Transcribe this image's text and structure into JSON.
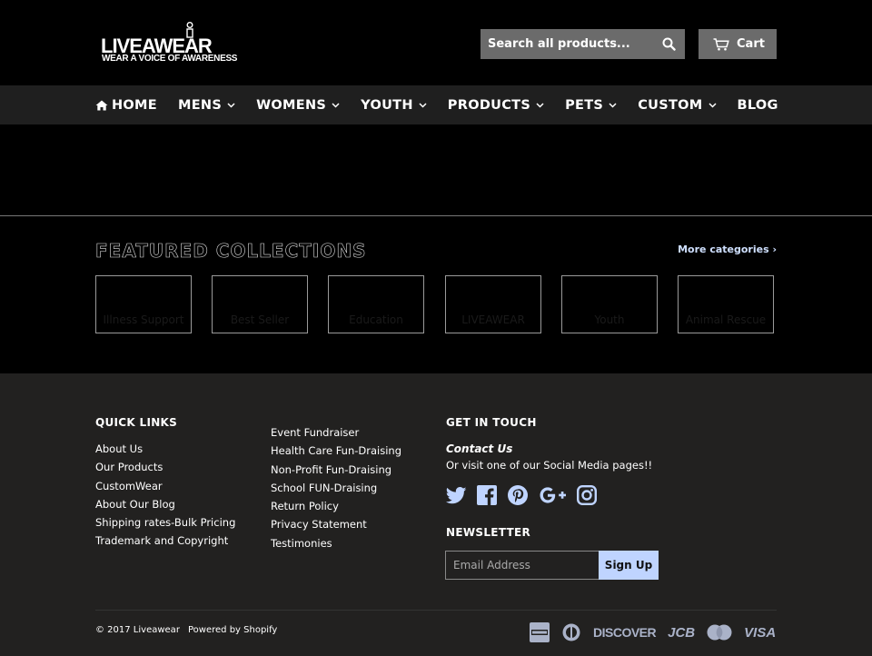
{
  "header": {
    "logo_text": "LIVEAWEAR",
    "logo_tagline": "WEAR A VOICE OF AWARENESS",
    "search_placeholder": "Search all products...",
    "cart_label": "Cart"
  },
  "nav": {
    "items": [
      {
        "label": "HOME",
        "icon": "home-icon",
        "dropdown": false
      },
      {
        "label": "MENS",
        "dropdown": true
      },
      {
        "label": "WOMENS",
        "dropdown": true
      },
      {
        "label": "YOUTH",
        "dropdown": true
      },
      {
        "label": "PRODUCTS",
        "dropdown": true
      },
      {
        "label": "PETS",
        "dropdown": true
      },
      {
        "label": "CUSTOM",
        "dropdown": true
      },
      {
        "label": "BLOG",
        "dropdown": false
      }
    ]
  },
  "featured": {
    "title": "FEATURED COLLECTIONS",
    "more_link": "More categories ›",
    "collections": [
      "Illness Support",
      "Best Seller",
      "Education",
      "LIVEAWEAR",
      "Youth",
      "Animal Rescue"
    ]
  },
  "footer": {
    "quick_links_title": "QUICK LINKS",
    "quick_links": [
      "About Us",
      "Our Products",
      "CustomWear",
      "About Our Blog",
      "Shipping rates-Bulk Pricing",
      "Trademark and Copyright"
    ],
    "more_links": [
      "Event Fundraiser",
      "Health Care Fun-Draising",
      "Non-Profit Fun-Draising",
      "School FUN-Draising",
      "Return Policy",
      "Privacy Statement",
      "Testimonies"
    ],
    "get_in_touch_title": "GET IN TOUCH",
    "contact_link": "Contact Us",
    "contact_text": "Or visit one of our Social Media pages!!",
    "social_icons": [
      "twitter-icon",
      "facebook-icon",
      "pinterest-icon",
      "google-plus-icon",
      "instagram-icon"
    ],
    "newsletter_title": "NEWSLETTER",
    "email_placeholder": "Email Address",
    "signup_label": "Sign Up",
    "copyright": "© 2017 Liveawear",
    "powered_by": "Powered by Shopify",
    "payment_icons": [
      "american-express",
      "diners-club",
      "discover",
      "jcb",
      "master",
      "visa"
    ],
    "payment_labels": {
      "discover": "DISCOVER",
      "jcb": "JCB",
      "visa": "VISA"
    }
  },
  "colors": {
    "header_bg": "#000000",
    "nav_bg": "#1f1f1f",
    "footer_bg": "#222120",
    "button_grey": "#6b6b6b",
    "accent": "#bfd4ff"
  }
}
